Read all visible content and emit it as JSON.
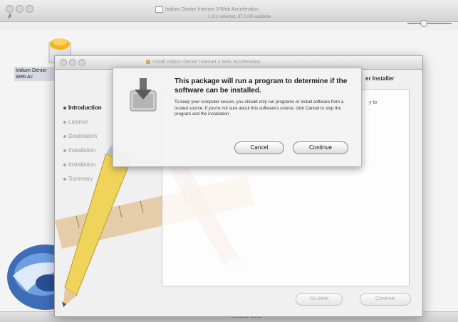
{
  "finder": {
    "title": "Iridium Denier Internet 3 Web Acceleration",
    "status": "1 of 1 selected, 87.1 KB available",
    "action_glyph": "✗",
    "package_label": "Iridium Denier Web Ac",
    "bottom_text": "Installer 1.0.2"
  },
  "installer": {
    "title": "Install Iridium Denier Internet 3 Web Acceleration",
    "heading": "er Installer",
    "steps": [
      "Introduction",
      "License",
      "Destination",
      "Installation",
      "Installation",
      "Summary"
    ],
    "pane_fragment": "y to",
    "go_back_label": "Go Back",
    "continue_label": "Continue"
  },
  "sheet": {
    "title": "This package will run a program to determine if the software can be installed.",
    "body": "To keep your computer secure, you should only run programs or install software from a trusted source. If you're not sure about this software's source, click Cancel to stop the program and the installation.",
    "cancel_label": "Cancel",
    "continue_label": "Continue"
  },
  "colors": {
    "accent_pencil": "#f0d35a",
    "ruler": "#d9b98a"
  }
}
